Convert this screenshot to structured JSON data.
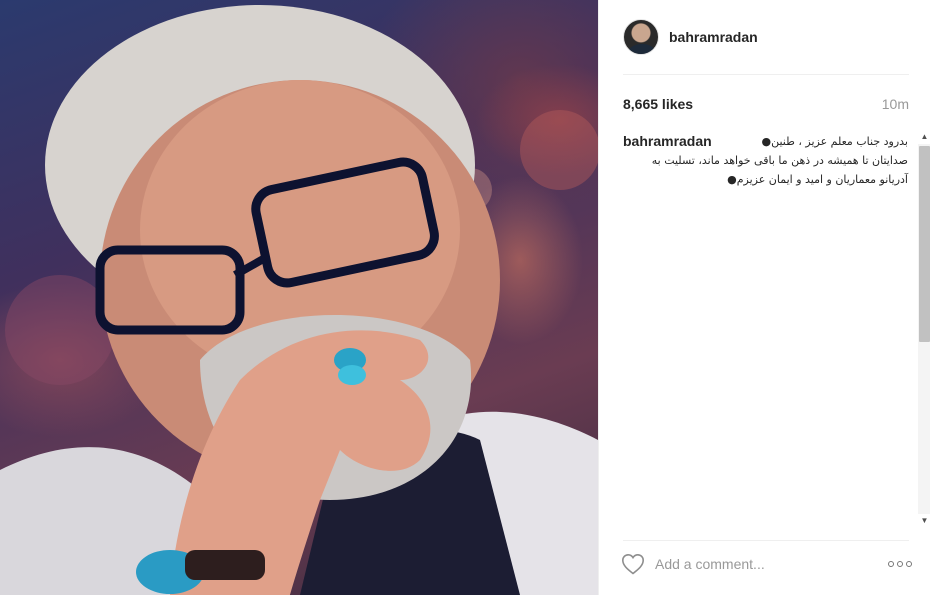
{
  "post": {
    "username": "bahramradan",
    "likes_text": "8,665 likes",
    "time_ago": "10m",
    "caption": {
      "username": "bahramradan",
      "lines": [
        "بدرود جناب معلم عزیز ، طنین●",
        "صدایتان تا همیشه در ذهن ما باقی خواهد ماند، تسلیت به",
        "آدریانو معماریان و امید و ایمان عزیزم●"
      ]
    }
  },
  "footer": {
    "comment_placeholder": "Add a comment..."
  },
  "icons": {
    "like": "heart-outline-icon",
    "more": "more-options-icon",
    "scroll_up": "scroll-up-arrow",
    "scroll_down": "scroll-down-arrow"
  },
  "colors": {
    "text": "#262626",
    "muted": "#999999",
    "divider": "#efefef"
  }
}
